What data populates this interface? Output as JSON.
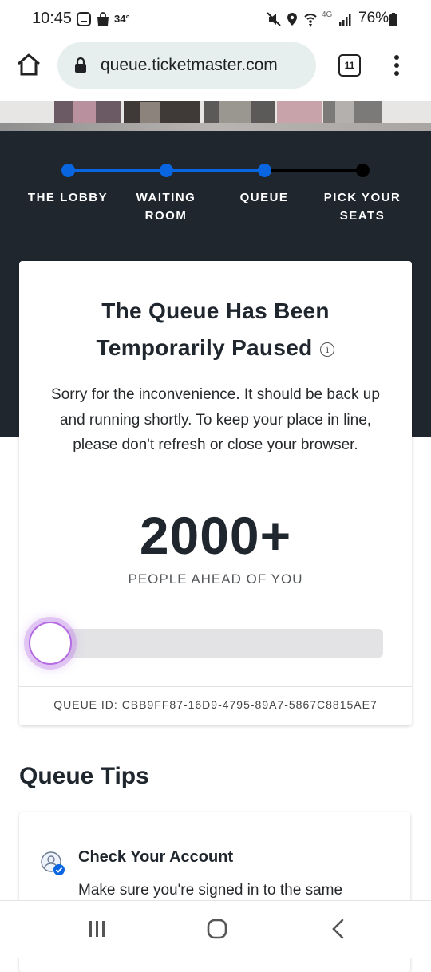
{
  "status_bar": {
    "time": "10:45",
    "temperature": "34°",
    "battery": "76%",
    "network": "4G"
  },
  "browser": {
    "url": "queue.ticketmaster.com",
    "tab_count": "11"
  },
  "progress_steps": [
    {
      "label_line1": "THE LOBBY",
      "label_line2": "",
      "complete": true
    },
    {
      "label_line1": "WAITING",
      "label_line2": "ROOM",
      "complete": true
    },
    {
      "label_line1": "QUEUE",
      "label_line2": "",
      "complete": true
    },
    {
      "label_line1": "PICK YOUR",
      "label_line2": "SEATS",
      "complete": false
    }
  ],
  "queue_card": {
    "title_line1": "The Queue Has Been",
    "title_line2": "Temporarily Paused",
    "info_glyph": "i",
    "message": "Sorry for the inconvenience. It should be back up and running shortly. To keep your place in line, please don't refresh or close your browser.",
    "people_ahead_count": "2000+",
    "people_ahead_label": "PEOPLE AHEAD OF YOU",
    "progress_fraction": 0.0,
    "queue_id": "QUEUE ID: CBB9FF87-16D9-4795-89A7-5867C8815AE7"
  },
  "tips": {
    "title": "Queue Tips",
    "items": [
      {
        "heading": "Check Your Account",
        "text": "Make sure you're signed in to the same"
      }
    ]
  },
  "colors": {
    "accent_blue": "#0a66e0",
    "dark_band": "#1f262d",
    "knob_glow": "#b46be3"
  }
}
